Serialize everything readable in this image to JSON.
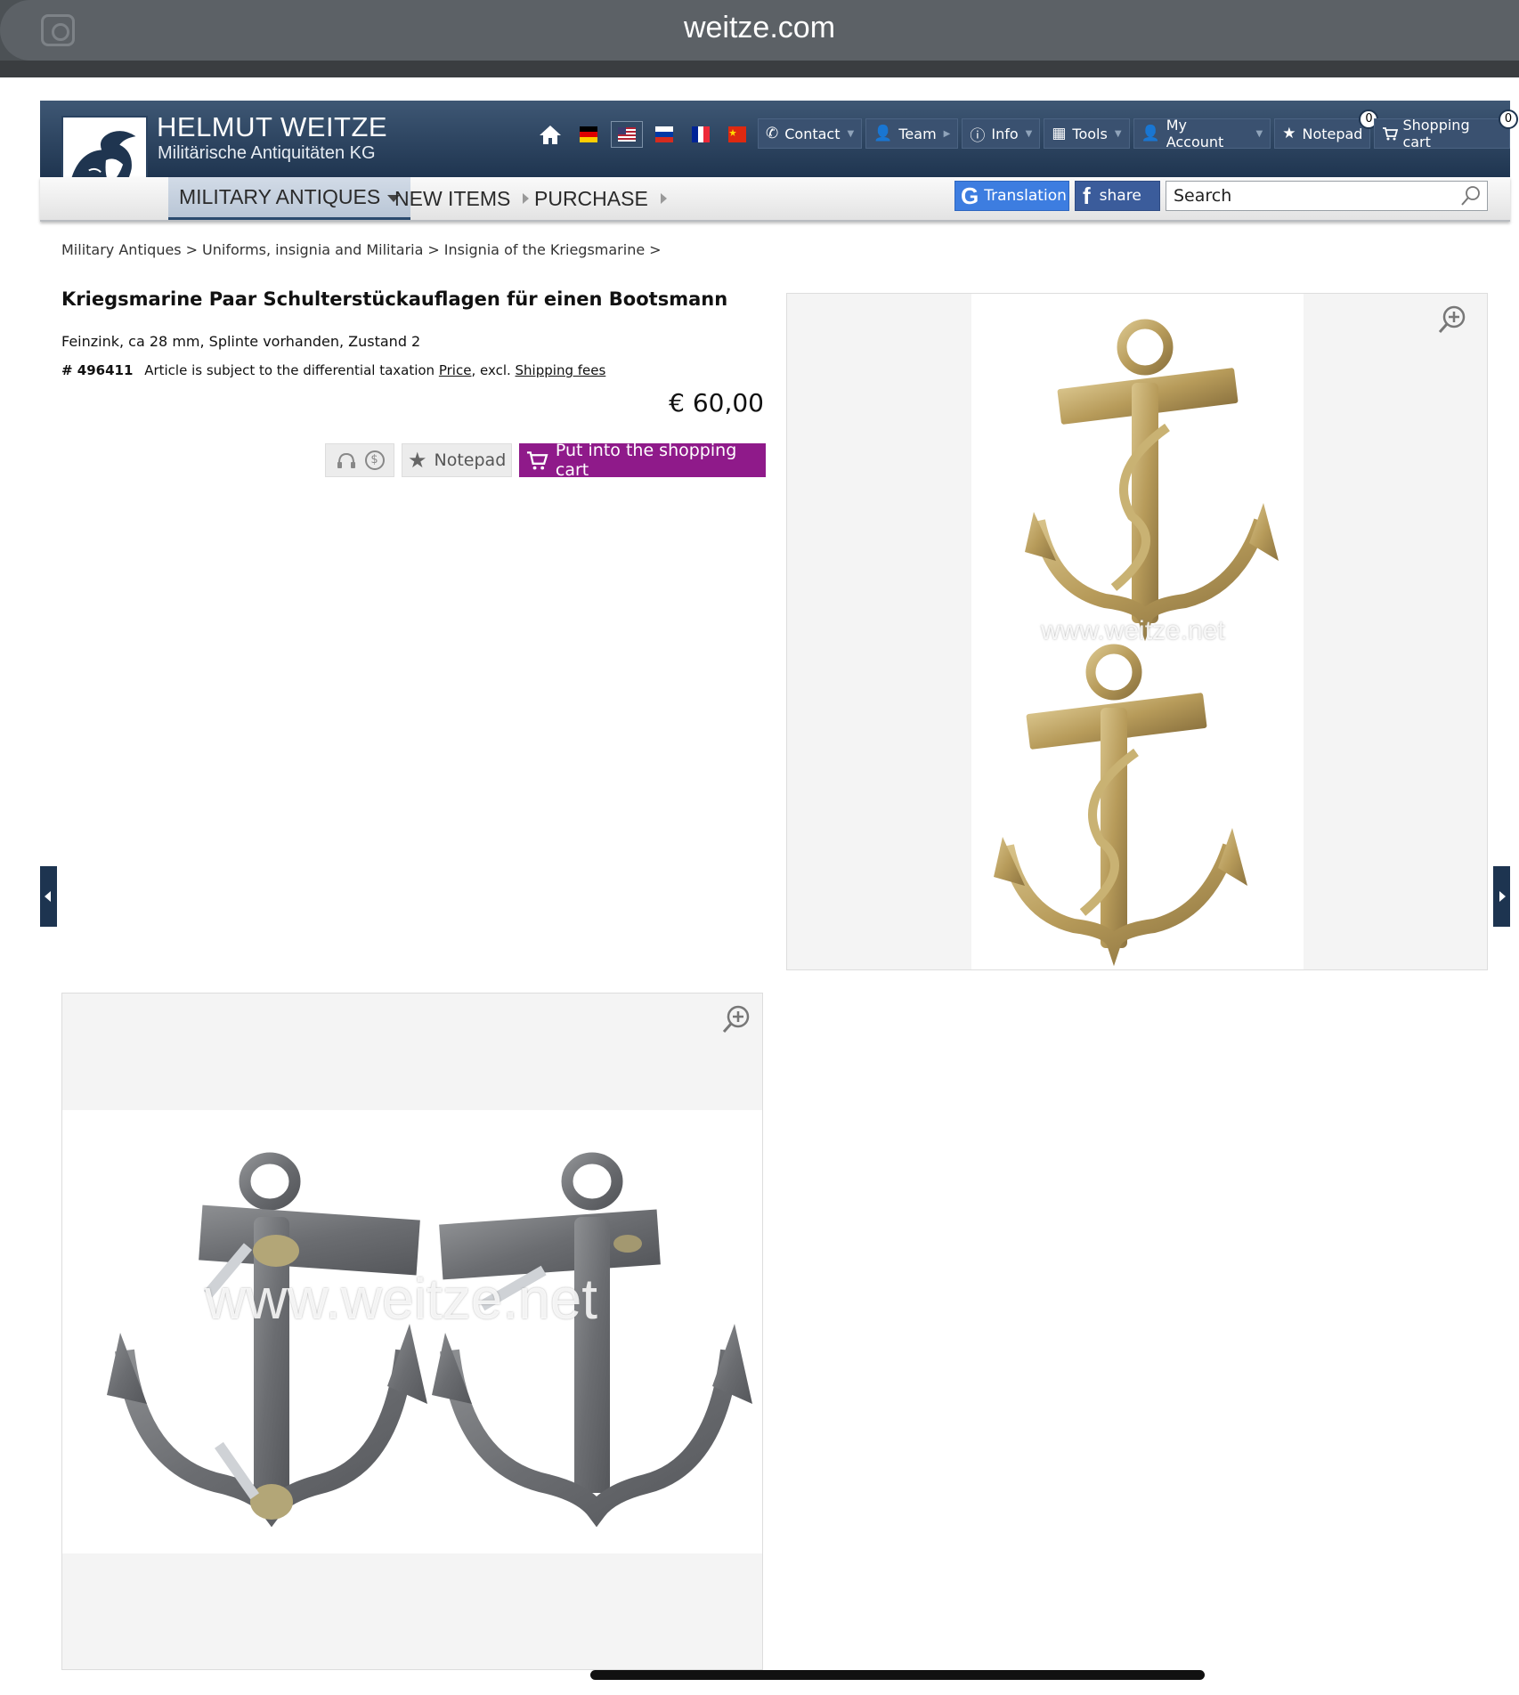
{
  "browser": {
    "url": "weitze.com"
  },
  "brand": {
    "title": "HELMUT WEITZE",
    "subtitle": "Militärische Antiquitäten KG"
  },
  "topnav": {
    "contact": "Contact",
    "team": "Team",
    "info": "Info",
    "tools": "Tools",
    "account": "My Account",
    "notepad": "Notepad",
    "notepad_count": "0",
    "cart": "Shopping cart",
    "cart_count": "0"
  },
  "mainnav": {
    "military": "MILITARY ANTIQUES",
    "new_items": "NEW ITEMS",
    "purchase": "PURCHASE"
  },
  "tools": {
    "translation": "Translation",
    "share": "share",
    "search_placeholder": "Search"
  },
  "breadcrumb": [
    "Military Antiques",
    ">",
    "Uniforms, insignia and Militaria",
    ">",
    "Insignia of the Kriegsmarine",
    ">"
  ],
  "product": {
    "title": "Kriegsmarine Paar Schulterstückauflagen für einen Bootsmann",
    "description": "Feinzink, ca 28 mm, Splinte vorhanden, Zustand 2",
    "article_no": "# 496411",
    "tax_text": "Article is subject to the differential taxation",
    "price_link": "Price",
    "excl": ", excl.",
    "shipping_link": "Shipping fees",
    "price": "€ 60,00",
    "notepad_label": "Notepad",
    "cart_label": "Put into the shopping cart"
  },
  "images": {
    "watermark": "www.weitze.net"
  },
  "colors": {
    "header": "#2a4260",
    "cart_button": "#8f1a8a",
    "translate": "#3d7de0",
    "share": "#3b5c9b"
  }
}
